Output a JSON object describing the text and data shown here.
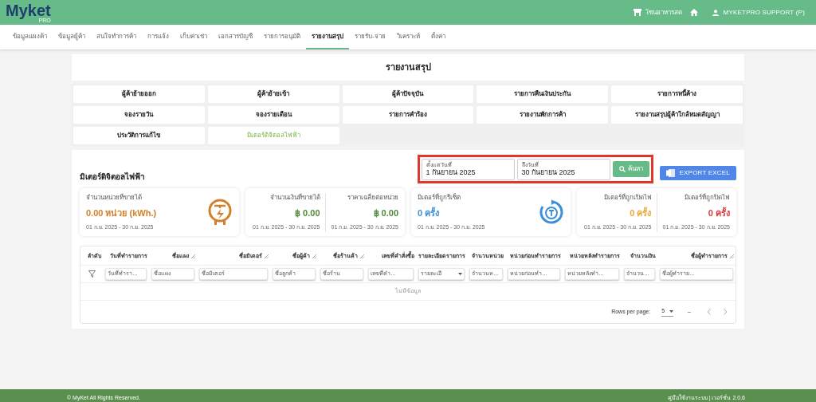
{
  "header": {
    "logo": "Myket",
    "logo_sub": "PRO",
    "zone": "โซนอาหารสด",
    "user": "MYKETPRO SUPPORT (P)"
  },
  "nav": [
    {
      "label": "ข้อมูลแผงค้า",
      "selected": false
    },
    {
      "label": "ข้อมูลผู้ค้า",
      "selected": false
    },
    {
      "label": "สนใจทำการค้า",
      "selected": false
    },
    {
      "label": "การแจ้ง",
      "selected": false
    },
    {
      "label": "เก็บค่าเช่า",
      "selected": false
    },
    {
      "label": "เอกสารบัญชี",
      "selected": false
    },
    {
      "label": "รายการอนุมัติ",
      "selected": false
    },
    {
      "label": "รายงานสรุป",
      "selected": true
    },
    {
      "label": "รายรับ-จ่าย",
      "selected": false
    },
    {
      "label": "วิเคราะห์",
      "selected": false
    },
    {
      "label": "ตั้งค่า",
      "selected": false
    }
  ],
  "page_title": "รายงานสรุป",
  "reports": [
    {
      "label": "ผู้ค้าย้ายออก",
      "selected": false
    },
    {
      "label": "ผู้ค้าย้ายเข้า",
      "selected": false
    },
    {
      "label": "ผู้ค้าปัจจุบัน",
      "selected": false
    },
    {
      "label": "รายการคืนเงินประกัน",
      "selected": false
    },
    {
      "label": "รายการหนี้ค้าง",
      "selected": false
    },
    {
      "label": "จองรายวัน",
      "selected": false
    },
    {
      "label": "จองรายเดือน",
      "selected": false
    },
    {
      "label": "รายการคำร้อง",
      "selected": false
    },
    {
      "label": "รายงานพักการค้า",
      "selected": false
    },
    {
      "label": "รายงานสรุปผู้ค้าใกล้หมดสัญญา",
      "selected": false
    },
    {
      "label": "ประวัติการแก้ไข",
      "selected": false
    },
    {
      "label": "มิเตอร์ดิจิตอลไฟฟ้า",
      "selected": true
    }
  ],
  "section": {
    "title": "มิเตอร์ดิจิตอลไฟฟ้า",
    "date_from": {
      "label": "ตั้งแต่วันที่",
      "value": "1 กันยายน 2025"
    },
    "date_to": {
      "label": "ถึงวันที่",
      "value": "30 กันยายน 2025"
    },
    "search_button": "ค้นหา",
    "export_button": "EXPORT EXCEL",
    "cards": [
      {
        "stats": [
          {
            "label": "จำนวนหน่วยที่ขายได้",
            "value": "0.00 หน่วย (kWh.)",
            "range": "01 ก.ย. 2025 - 30 ก.ย. 2025",
            "color": "#d2802a"
          }
        ]
      },
      {
        "stats": [
          {
            "label": "จำนวนเงินที่ขายได้",
            "value": "฿ 0.00",
            "range": "01 ก.ย. 2025 - 30 ก.ย. 2025",
            "color": "#4e8a3a"
          },
          {
            "label": "ราคาเฉลี่ยต่อหน่วย",
            "value": "฿ 0.00",
            "range": "01 ก.ย. 2025 - 30 ก.ย. 2025",
            "color": "#4e8a3a"
          }
        ]
      },
      {
        "stats": [
          {
            "label": "มิเตอร์ที่ถูกรีเซ็ต",
            "value": "0 ครั้ง",
            "range": "01 ก.ย. 2025 - 30 ก.ย. 2025",
            "color": "#3d8fd8"
          }
        ]
      },
      {
        "stats": [
          {
            "label": "มิเตอร์ที่ถูกเปิดไฟ",
            "value": "0 ครั้ง",
            "range": "01 ก.ย. 2025 - 30 ก.ย. 2025",
            "color": "#e9a83a"
          },
          {
            "label": "มิเตอร์ที่ถูกปิดไฟ",
            "value": "0 ครั้ง",
            "range": "01 ก.ย. 2025 - 30 ก.ย. 2025",
            "color": "#d93b3b"
          }
        ]
      }
    ]
  },
  "table": {
    "columns": [
      {
        "label": "ลำดับ",
        "resizable": false
      },
      {
        "label": "วันที่ทำรายการ",
        "resizable": false,
        "filter": "วันที่ทำรา…"
      },
      {
        "label": "ชื่อแผง",
        "resizable": true,
        "filter": "ชื่อแผง"
      },
      {
        "label": "ชื่อมิเตอร์",
        "resizable": true,
        "filter": "ชื่อมิเตอร์"
      },
      {
        "label": "ชื่อผู้ค้า",
        "resizable": true,
        "filter": "ชื่อลูกค้า"
      },
      {
        "label": "ชื่อร้านค้า",
        "resizable": true,
        "filter": "ชื่อร้าน"
      },
      {
        "label": "เลขที่คำสั่งซื้อ",
        "resizable": false,
        "filter": "เลขที่คำ…"
      },
      {
        "label": "รายละเอียดรายการ",
        "resizable": false,
        "filter": "รายละเอี"
      },
      {
        "label": "จำนวนหน่วย",
        "resizable": false,
        "filter": "จำนวนห…"
      },
      {
        "label": "หน่วยก่อนทำรายการ",
        "resizable": false,
        "filter": "หน่วยก่อนทำ…"
      },
      {
        "label": "หน่วยหลังทำรายการ",
        "resizable": false,
        "filter": "หน่วยหลังทำ…"
      },
      {
        "label": "จำนวนเงิน",
        "resizable": false,
        "filter": "จำนวน…"
      },
      {
        "label": "ชื่อผู้ทำรายการ",
        "resizable": true,
        "filter": "ชื่อผู้ทำราย…"
      }
    ],
    "empty": "ไม่มีข้อมูล",
    "rows_per_page_label": "Rows per page:",
    "rows_per_page": "5",
    "range": "–"
  },
  "footer": {
    "copyright": "© MyKet All Rights Reserved.",
    "links": "คู่มือใช้งานระบบ | เวอร์ชั่น 2.0.6"
  }
}
